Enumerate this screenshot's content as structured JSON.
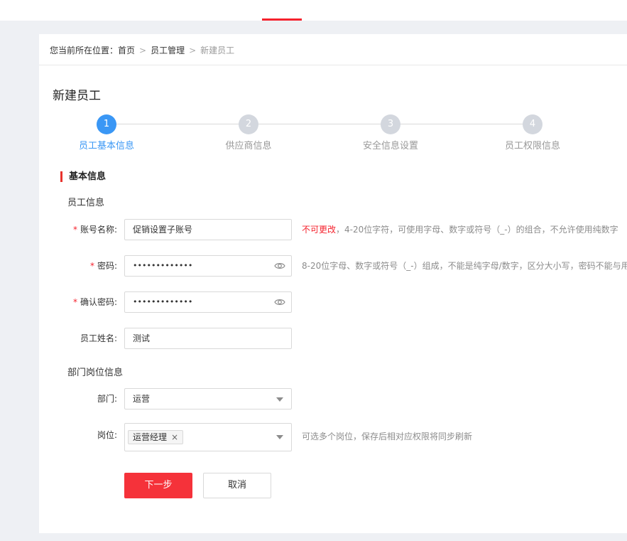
{
  "breadcrumb": {
    "prefix": "您当前所在位置：",
    "items": [
      "首页",
      "员工管理"
    ],
    "current": "新建员工",
    "separator": ">"
  },
  "page_title": "新建员工",
  "steps": [
    {
      "number": "1",
      "label": "员工基本信息",
      "active": true
    },
    {
      "number": "2",
      "label": "供应商信息",
      "active": false
    },
    {
      "number": "3",
      "label": "安全信息设置",
      "active": false
    },
    {
      "number": "4",
      "label": "员工权限信息",
      "active": false
    }
  ],
  "section_title": "基本信息",
  "employee_info": {
    "title": "员工信息",
    "account": {
      "required": "*",
      "label": "账号名称:",
      "value": "促销设置子账号",
      "hint_warn": "不可更改",
      "hint": "，4-20位字符，可使用字母、数字或符号（_-）的组合，不允许使用纯数字"
    },
    "password": {
      "required": "*",
      "label": "密码:",
      "value": "•••••••••••••",
      "hint": "8-20位字母、数字或符号（_-）组成，不能是纯字母/数字，区分大小写，密码不能与用"
    },
    "confirm_password": {
      "required": "*",
      "label": "确认密码:",
      "value": "•••••••••••••"
    },
    "name": {
      "label": "员工姓名:",
      "value": "测试"
    }
  },
  "dept_info": {
    "title": "部门岗位信息",
    "department": {
      "label": "部门:",
      "value": "运营"
    },
    "position": {
      "label": "岗位:",
      "tag": "运营经理",
      "tag_close": "×",
      "hint": "可选多个岗位，保存后相对应权限将同步刷新"
    }
  },
  "buttons": {
    "next": "下一步",
    "cancel": "取消"
  },
  "colors": {
    "accent": "#3a97f5",
    "primary_button": "#f5323a",
    "required": "#f5222d",
    "section_bar": "#e8332d"
  },
  "icons": [
    "eye-icon",
    "caret-down-icon",
    "tag-close-icon"
  ]
}
